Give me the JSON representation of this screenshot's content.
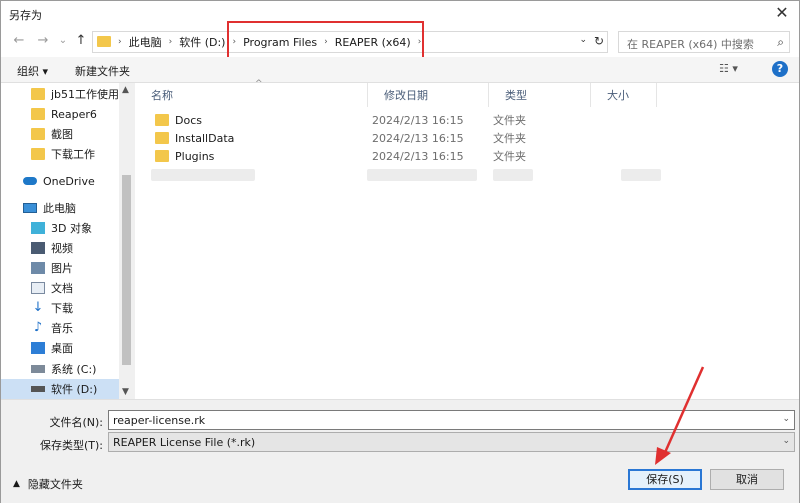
{
  "window": {
    "title": "另存为",
    "close": "✕"
  },
  "nav": {
    "back": "←",
    "forward": "→",
    "down": "⌄",
    "up": "↑",
    "breadcrumbs": [
      "此电脑",
      "软件 (D:)",
      "Program Files",
      "REAPER (x64)"
    ],
    "separator": "›",
    "dropdown": "⌄",
    "refresh": "↻",
    "search_placeholder": "在 REAPER (x64) 中搜索",
    "search_icon": "⌕"
  },
  "toolbar": {
    "organize": "组织 ▾",
    "new_folder": "新建文件夹",
    "view": "☷ ▾",
    "help": "?"
  },
  "sidebar": {
    "items": [
      {
        "label": "jb51工作使用",
        "icon": "folder-icon"
      },
      {
        "label": "Reaper6",
        "icon": "folder-icon"
      },
      {
        "label": "截图",
        "icon": "folder-icon"
      },
      {
        "label": "下载工作",
        "icon": "folder-icon"
      },
      {
        "label": "OneDrive",
        "icon": "cloud-icon"
      },
      {
        "label": "此电脑",
        "icon": "pc-icon"
      },
      {
        "label": "3D 对象",
        "icon": "3d-objects-icon"
      },
      {
        "label": "视频",
        "icon": "video-icon"
      },
      {
        "label": "图片",
        "icon": "pictures-icon"
      },
      {
        "label": "文档",
        "icon": "documents-icon"
      },
      {
        "label": "下载",
        "icon": "download-icon"
      },
      {
        "label": "音乐",
        "icon": "music-icon"
      },
      {
        "label": "桌面",
        "icon": "desktop-icon"
      },
      {
        "label": "系统 (C:)",
        "icon": "system-drive-icon"
      },
      {
        "label": "软件 (D:)",
        "icon": "drive-icon"
      }
    ],
    "scroll_up": "▲",
    "scroll_down": "▼"
  },
  "columns": {
    "name": "名称",
    "modified": "修改日期",
    "type": "类型",
    "size": "大小",
    "sort": "^"
  },
  "files": [
    {
      "name": "Docs",
      "modified": "2024/2/13 16:15",
      "type": "文件夹"
    },
    {
      "name": "InstallData",
      "modified": "2024/2/13 16:15",
      "type": "文件夹"
    },
    {
      "name": "Plugins",
      "modified": "2024/2/13 16:15",
      "type": "文件夹"
    }
  ],
  "form": {
    "filename_label": "文件名(N):",
    "filename_value": "reaper-license.rk",
    "type_label": "保存类型(T):",
    "type_value": "REAPER License File (*.rk)",
    "dropdown": "⌄"
  },
  "footer": {
    "hide_folders": "隐藏文件夹",
    "chevron": "▲",
    "save": "保存(S)",
    "cancel": "取消"
  },
  "colors": {
    "highlight": "#e03030",
    "accent": "#2a77d4",
    "folder": "#f3c74b"
  }
}
